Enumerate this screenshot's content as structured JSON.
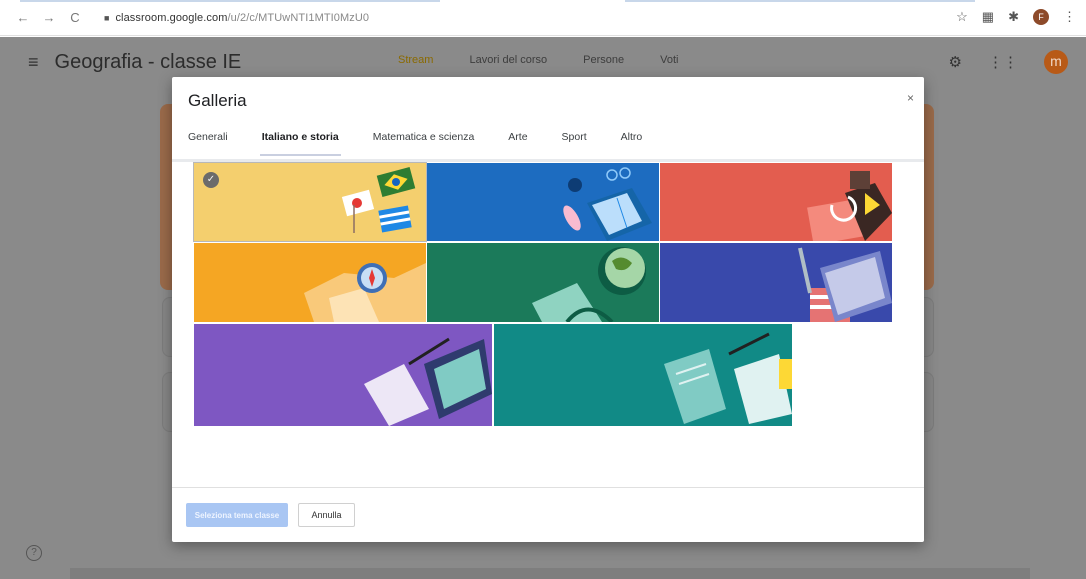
{
  "browser": {
    "url_host": "classroom.google.com",
    "url_path": "/u/2/c/MTUwNTI1MTI0MzU0",
    "profile_initial": "F"
  },
  "app": {
    "class_name": "Geografia - classe IE",
    "tabs": [
      {
        "label": "Stream",
        "active": true
      },
      {
        "label": "Lavori del corso",
        "active": false
      },
      {
        "label": "Persone",
        "active": false
      },
      {
        "label": "Voti",
        "active": false
      }
    ],
    "avatar_initial": "m"
  },
  "modal": {
    "title": "Galleria",
    "close": "×",
    "tabs": [
      {
        "label": "Generali",
        "active": false
      },
      {
        "label": "Italiano e storia",
        "active": true
      },
      {
        "label": "Matematica e scienza",
        "active": false
      },
      {
        "label": "Arte",
        "active": false
      },
      {
        "label": "Sport",
        "active": false
      },
      {
        "label": "Altro",
        "active": false
      }
    ],
    "selected_theme_index": 0,
    "primary_button": "Seleziona tema classe",
    "cancel_button": "Annulla"
  },
  "colors": {
    "tile_yellow": "#f4cf6e",
    "tile_blue": "#1d6cc0",
    "tile_red": "#e35d4f",
    "tile_orange": "#f5a623",
    "tile_green": "#1b7a5a",
    "tile_indigo": "#3949ab",
    "tile_purple": "#7e57c2",
    "tile_teal": "#118a86"
  }
}
